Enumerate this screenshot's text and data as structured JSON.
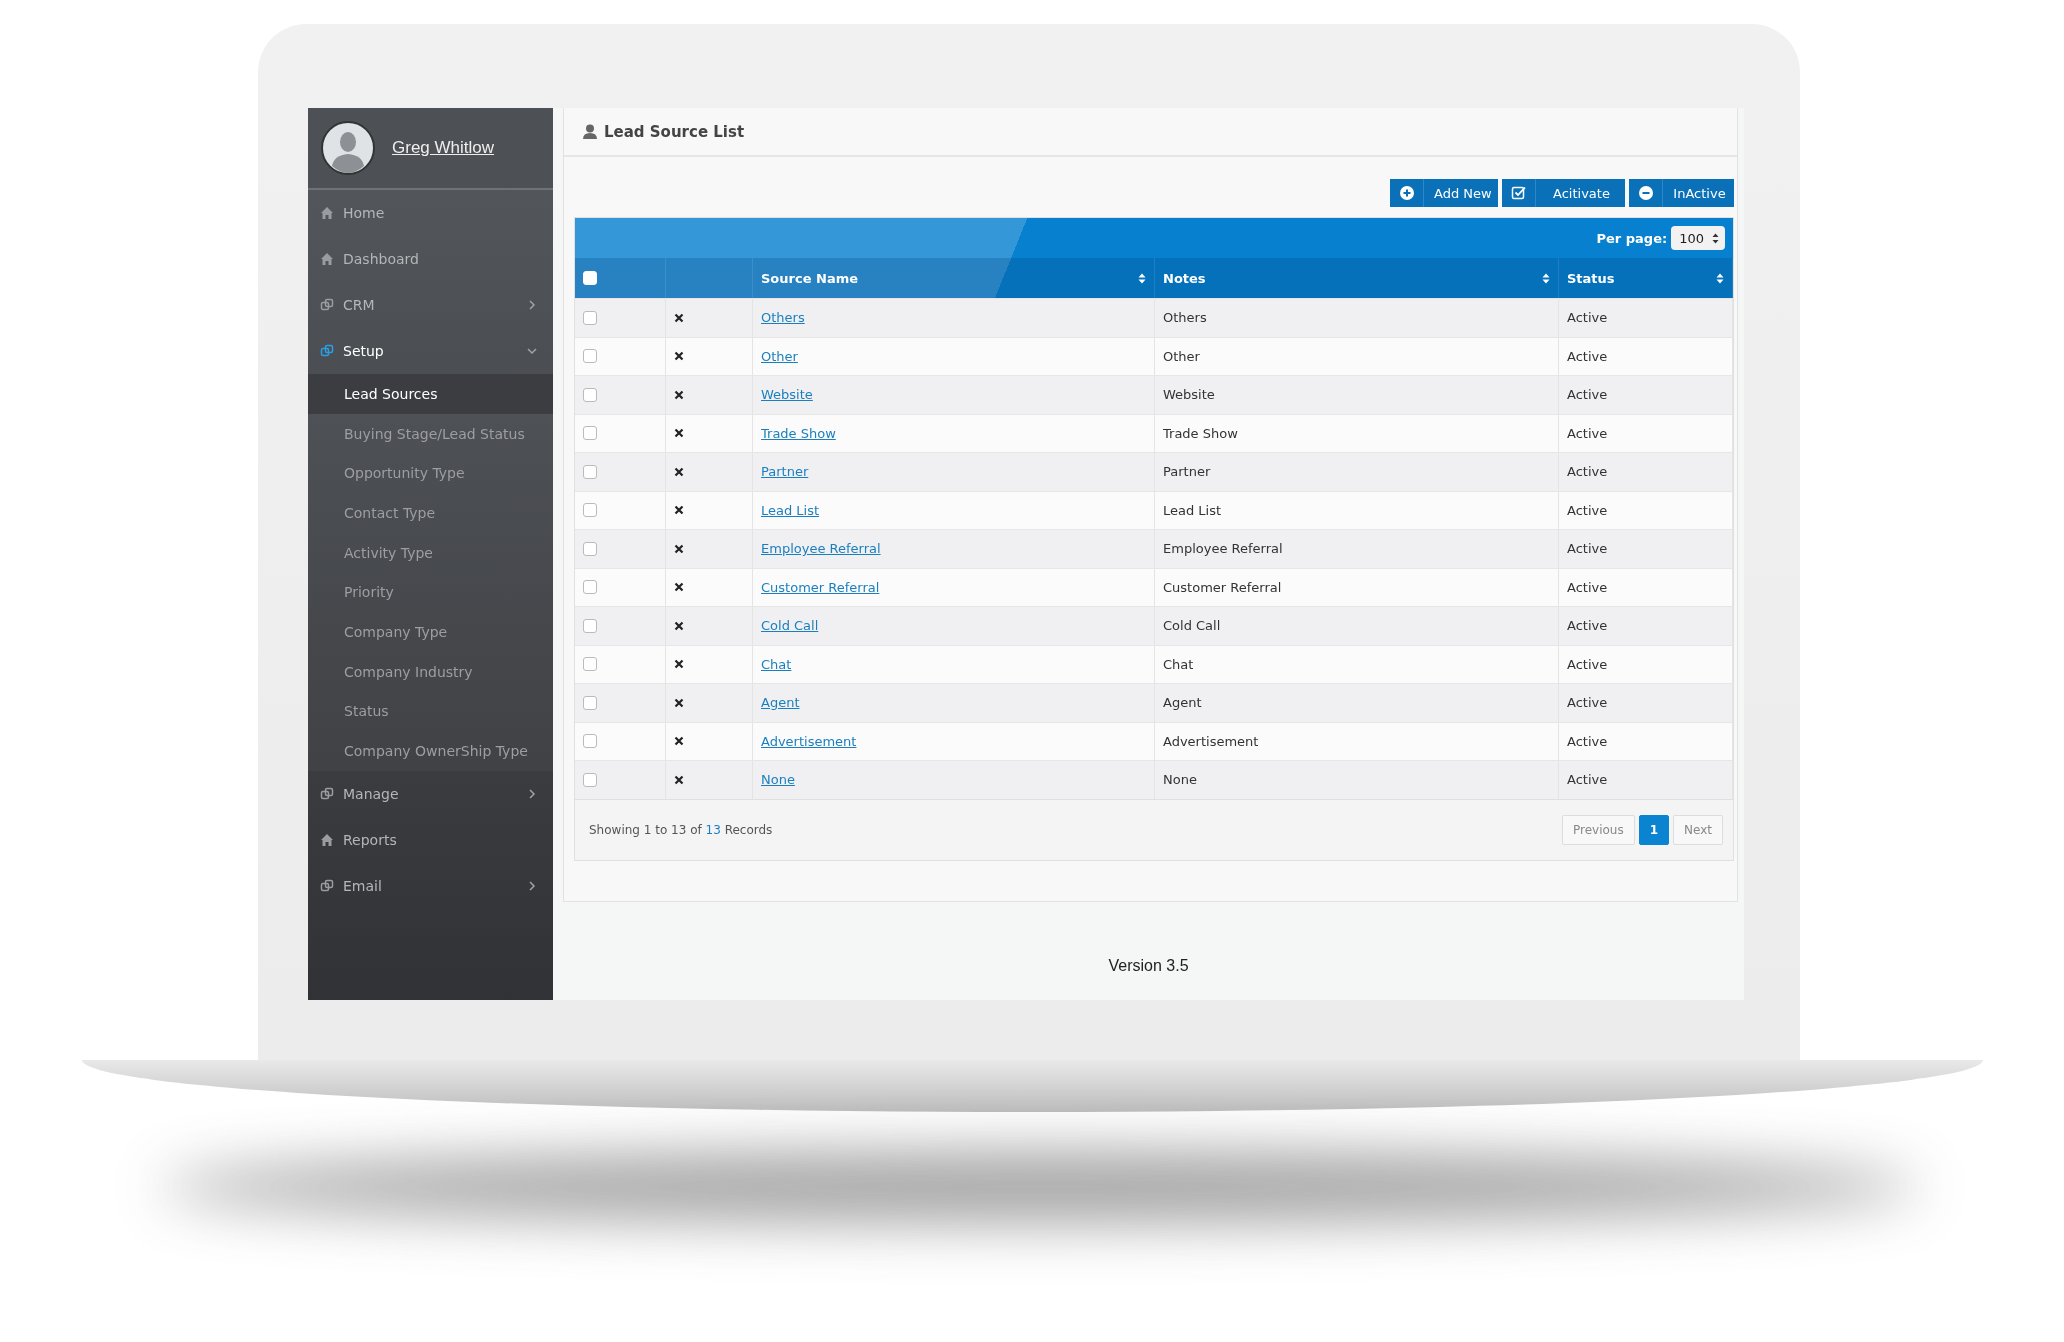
{
  "user": {
    "name": "Greg Whitlow"
  },
  "sidebar": {
    "items": [
      {
        "label": "Home",
        "kind": "link",
        "selected": false
      },
      {
        "label": "Dashboard",
        "kind": "link",
        "selected": false
      },
      {
        "label": "CRM",
        "kind": "group",
        "selected": false,
        "expanded": false
      },
      {
        "label": "Setup",
        "kind": "group",
        "selected": true,
        "expanded": true,
        "children": [
          {
            "label": "Lead Sources",
            "selected": true
          },
          {
            "label": "Buying Stage/Lead Status",
            "selected": false
          },
          {
            "label": "Opportunity Type",
            "selected": false
          },
          {
            "label": "Contact Type",
            "selected": false
          },
          {
            "label": "Activity Type",
            "selected": false
          },
          {
            "label": "Priority",
            "selected": false
          },
          {
            "label": "Company Type",
            "selected": false
          },
          {
            "label": "Company Industry",
            "selected": false
          },
          {
            "label": "Status",
            "selected": false
          },
          {
            "label": "Company OwnerShip Type",
            "selected": false
          }
        ]
      },
      {
        "label": "Manage",
        "kind": "group",
        "selected": false,
        "expanded": false
      },
      {
        "label": "Reports",
        "kind": "link",
        "selected": false
      },
      {
        "label": "Email",
        "kind": "group",
        "selected": false,
        "expanded": false
      }
    ]
  },
  "panel": {
    "title": "Lead Source List"
  },
  "toolbar": {
    "buttons": [
      {
        "label": "Add New",
        "kind": "add"
      },
      {
        "label": "Acitivate",
        "kind": "activate"
      },
      {
        "label": "InActive",
        "kind": "inactive"
      }
    ]
  },
  "per_page": {
    "label": "Per page:",
    "value": "100"
  },
  "table": {
    "select_all": {
      "checked": false
    },
    "columns": [
      {
        "label": "Source Name",
        "sortable": true
      },
      {
        "label": "Notes",
        "sortable": true
      },
      {
        "label": "Status",
        "sortable": true
      }
    ],
    "rows": [
      {
        "checked": false,
        "source_name": "Others",
        "notes": "Others",
        "status": "Active"
      },
      {
        "checked": false,
        "source_name": "Other",
        "notes": "Other",
        "status": "Active"
      },
      {
        "checked": false,
        "source_name": "Website",
        "notes": "Website",
        "status": "Active"
      },
      {
        "checked": false,
        "source_name": "Trade Show",
        "notes": "Trade Show",
        "status": "Active"
      },
      {
        "checked": false,
        "source_name": "Partner",
        "notes": "Partner",
        "status": "Active"
      },
      {
        "checked": false,
        "source_name": "Lead List",
        "notes": "Lead List",
        "status": "Active"
      },
      {
        "checked": false,
        "source_name": "Employee Referral",
        "notes": "Employee Referral",
        "status": "Active"
      },
      {
        "checked": false,
        "source_name": "Customer Referral",
        "notes": "Customer Referral",
        "status": "Active"
      },
      {
        "checked": false,
        "source_name": "Cold Call",
        "notes": "Cold Call",
        "status": "Active"
      },
      {
        "checked": false,
        "source_name": "Chat",
        "notes": "Chat",
        "status": "Active"
      },
      {
        "checked": false,
        "source_name": "Agent",
        "notes": "Agent",
        "status": "Active"
      },
      {
        "checked": false,
        "source_name": "Advertisement",
        "notes": "Advertisement",
        "status": "Active"
      },
      {
        "checked": false,
        "source_name": "None",
        "notes": "None",
        "status": "Active"
      }
    ]
  },
  "record_summary": {
    "prefix": "Showing 1 to 13 of",
    "total": "13",
    "suffix": "Records"
  },
  "pagination": {
    "previous": "Previous",
    "pages": [
      {
        "label": "1",
        "selected": true
      }
    ],
    "next": "Next"
  },
  "footer": {
    "version": "Version 3.5"
  }
}
